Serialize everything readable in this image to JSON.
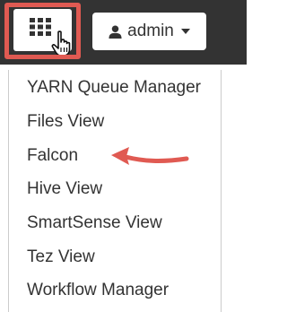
{
  "colors": {
    "topbar_background": "#333333",
    "highlight_border": "#e05a52",
    "arrow": "#e05a52",
    "menu_text": "#333333"
  },
  "apps_button": {
    "icon": "grid-icon",
    "cursor": "hand-pointer-icon"
  },
  "user_menu": {
    "icon": "user-icon",
    "label": "admin",
    "caret": "caret-down-icon"
  },
  "menu": {
    "items": [
      "YARN Queue Manager",
      "Files View",
      "Falcon",
      "Hive View",
      "SmartSense View",
      "Tez View",
      "Workflow Manager"
    ]
  },
  "annotation": {
    "arrow_points_to": "Falcon",
    "icon": "left-arrow-icon"
  }
}
